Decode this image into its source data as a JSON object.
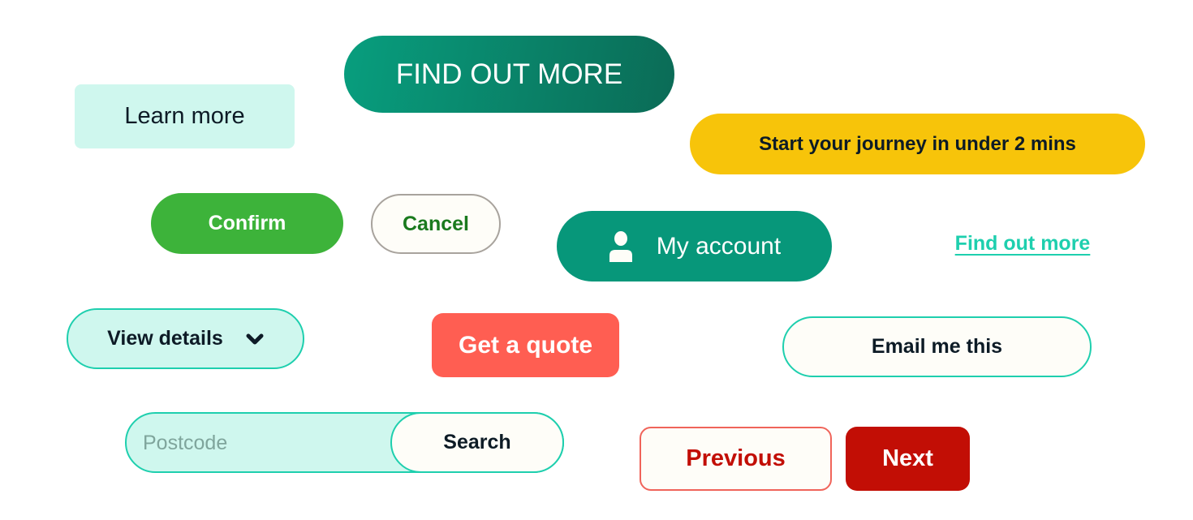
{
  "buttons": {
    "learn_more": "Learn more",
    "find_out_more_caps": "FIND OUT MORE",
    "start_journey": "Start your journey in under 2 mins",
    "confirm": "Confirm",
    "cancel": "Cancel",
    "my_account": "My account",
    "find_out_more_link": "Find out more",
    "view_details": "View details",
    "get_quote": "Get a quote",
    "email_me": "Email me this",
    "search": "Search",
    "previous": "Previous",
    "next": "Next"
  },
  "postcode": {
    "placeholder": "Postcode",
    "value": ""
  },
  "icons": {
    "account": "user-icon",
    "dropdown": "chevron-down-icon"
  },
  "colors": {
    "mint": "#cff7ee",
    "teal": "#07977a",
    "teal_border": "#1ecfae",
    "yellow": "#f7c40a",
    "green": "#3db33a",
    "coral": "#ff5e52",
    "red": "#c20e05",
    "cream": "#fefdf8"
  }
}
